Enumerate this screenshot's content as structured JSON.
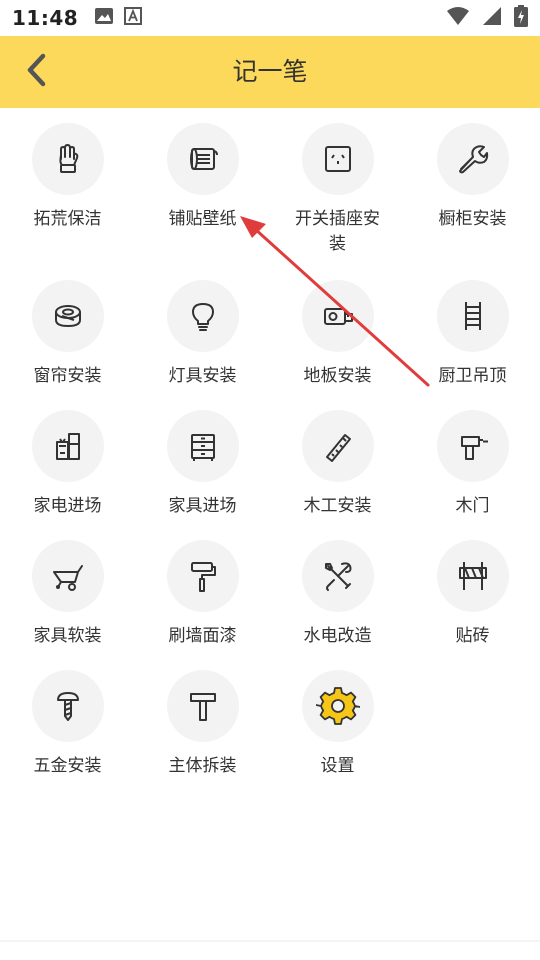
{
  "status_bar": {
    "time": "11:48",
    "left_icons": [
      "image-icon",
      "font-a-icon"
    ],
    "right_icons": [
      "wifi-icon",
      "signal-icon",
      "battery-charging-icon"
    ]
  },
  "header": {
    "title": "记一笔",
    "background": "#fcd95a",
    "back_icon": "chevron-left-icon"
  },
  "grid": {
    "items": [
      {
        "label": "拓荒保洁",
        "icon": "glove-icon"
      },
      {
        "label": "铺贴壁纸",
        "icon": "wallpaper-roll-icon"
      },
      {
        "label": "开关插座安装",
        "icon": "power-outlet-icon"
      },
      {
        "label": "橱柜安装",
        "icon": "wrench-icon"
      },
      {
        "label": "窗帘安装",
        "icon": "tape-roll-icon"
      },
      {
        "label": "灯具安装",
        "icon": "lightbulb-icon"
      },
      {
        "label": "地板安装",
        "icon": "tape-measure-icon"
      },
      {
        "label": "厨卫吊顶",
        "icon": "ladder-icon"
      },
      {
        "label": "家电进场",
        "icon": "appliances-icon"
      },
      {
        "label": "家具进场",
        "icon": "cabinet-icon"
      },
      {
        "label": "木工安装",
        "icon": "saw-icon"
      },
      {
        "label": "木门",
        "icon": "drill-icon"
      },
      {
        "label": "家具软装",
        "icon": "wheelbarrow-icon"
      },
      {
        "label": "刷墙面漆",
        "icon": "paint-roller-icon"
      },
      {
        "label": "水电改造",
        "icon": "tools-icon"
      },
      {
        "label": "贴砖",
        "icon": "barrier-icon"
      },
      {
        "label": "五金安装",
        "icon": "screw-icon"
      },
      {
        "label": "主体拆装",
        "icon": "hammer-icon"
      },
      {
        "label": "设置",
        "icon": "gear-icon"
      }
    ]
  },
  "annotation": {
    "arrow_color": "#e03c3c",
    "points_to": "铺贴壁纸"
  }
}
